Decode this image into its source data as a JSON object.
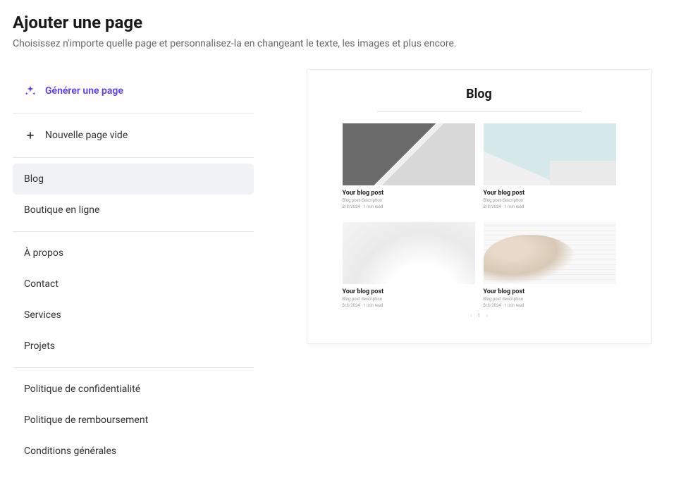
{
  "header": {
    "title": "Ajouter une page",
    "subtitle": "Choisissez n'importe quelle page et personnalisez-la en changeant le texte, les images et plus encore."
  },
  "sidebar": {
    "generate_label": "Générer une page",
    "new_blank_label": "Nouvelle page vide",
    "groups": [
      {
        "items": [
          {
            "label": "Blog",
            "active": true
          },
          {
            "label": "Boutique en ligne",
            "active": false
          }
        ]
      },
      {
        "items": [
          {
            "label": "À propos",
            "active": false
          },
          {
            "label": "Contact",
            "active": false
          },
          {
            "label": "Services",
            "active": false
          },
          {
            "label": "Projets",
            "active": false
          }
        ]
      },
      {
        "items": [
          {
            "label": "Politique de confidentialité",
            "active": false
          },
          {
            "label": "Politique de remboursement",
            "active": false
          },
          {
            "label": "Conditions générales",
            "active": false
          }
        ]
      }
    ]
  },
  "preview": {
    "title": "Blog",
    "posts": [
      {
        "title": "Your blog post",
        "desc": "Blog post description",
        "meta": "8/8/2024 · 1 min read"
      },
      {
        "title": "Your blog post",
        "desc": "Blog post description",
        "meta": "8/8/2024 · 1 min read"
      },
      {
        "title": "Your blog post",
        "desc": "Blog post description",
        "meta": "8/8/2024 · 1 min read"
      },
      {
        "title": "Your blog post",
        "desc": "Blog post description",
        "meta": "8/8/2024 · 1 min read"
      }
    ],
    "pagination": {
      "current": "1"
    }
  }
}
